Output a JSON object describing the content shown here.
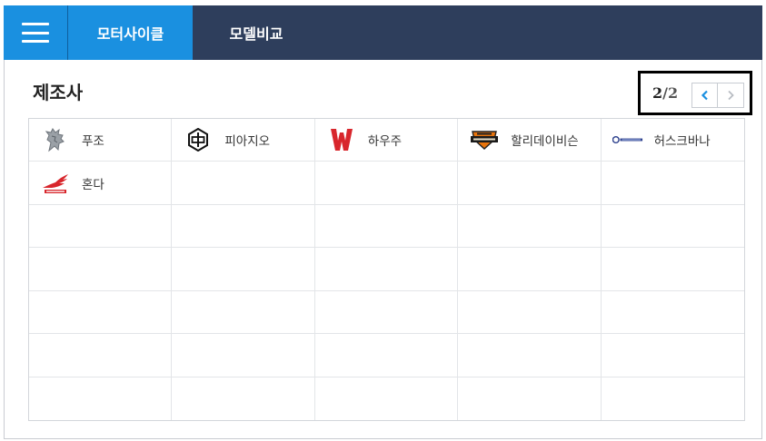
{
  "header": {
    "menu_icon": "hamburger-menu-icon",
    "tabs": [
      {
        "label": "모터사이클",
        "active": true
      },
      {
        "label": "모델비교",
        "active": false
      }
    ],
    "colors": {
      "bar": "#2e3e5c",
      "active": "#1a90e0"
    }
  },
  "main": {
    "title": "제조사",
    "pager": {
      "current": "2",
      "separator": "/",
      "total": "2",
      "prev_icon": "chevron-left-icon",
      "next_icon": "chevron-right-icon"
    },
    "manufacturers": [
      {
        "name": "푸조",
        "logo": "peugeot-lion-logo"
      },
      {
        "name": "피아지오",
        "logo": "piaggio-logo"
      },
      {
        "name": "하우주",
        "logo": "red-w-logo"
      },
      {
        "name": "할리데이비슨",
        "logo": "harley-davidson-logo"
      },
      {
        "name": "허스크바나",
        "logo": "husqvarna-logo"
      },
      {
        "name": "혼다",
        "logo": "honda-wing-logo"
      }
    ]
  }
}
